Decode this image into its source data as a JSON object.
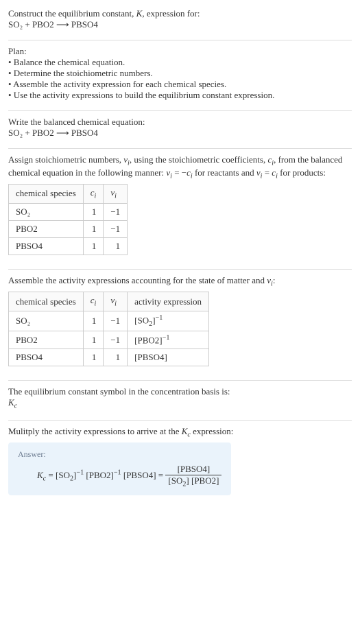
{
  "intro": {
    "line1": "Construct the equilibrium constant, K, expression for:",
    "equation": "SO₂ + PBO2  ⟶  PBSO4"
  },
  "plan": {
    "heading": "Plan:",
    "items": [
      "• Balance the chemical equation.",
      "• Determine the stoichiometric numbers.",
      "• Assemble the activity expression for each chemical species.",
      "• Use the activity expressions to build the equilibrium constant expression."
    ]
  },
  "balanced": {
    "heading": "Write the balanced chemical equation:",
    "equation": "SO₂ + PBO2  ⟶  PBSO4"
  },
  "stoich": {
    "text": "Assign stoichiometric numbers, νᵢ, using the stoichiometric coefficients, cᵢ, from the balanced chemical equation in the following manner: νᵢ = −cᵢ for reactants and νᵢ = cᵢ for products:",
    "headers": [
      "chemical species",
      "cᵢ",
      "νᵢ"
    ],
    "rows": [
      {
        "species": "SO₂",
        "c": "1",
        "v": "−1"
      },
      {
        "species": "PBO2",
        "c": "1",
        "v": "−1"
      },
      {
        "species": "PBSO4",
        "c": "1",
        "v": "1"
      }
    ]
  },
  "activity": {
    "text": "Assemble the activity expressions accounting for the state of matter and νᵢ:",
    "headers": [
      "chemical species",
      "cᵢ",
      "νᵢ",
      "activity expression"
    ],
    "rows": [
      {
        "species": "SO₂",
        "c": "1",
        "v": "−1",
        "expr": "[SO₂]⁻¹"
      },
      {
        "species": "PBO2",
        "c": "1",
        "v": "−1",
        "expr": "[PBO2]⁻¹"
      },
      {
        "species": "PBSO4",
        "c": "1",
        "v": "1",
        "expr": "[PBSO4]"
      }
    ]
  },
  "symbol": {
    "line1": "The equilibrium constant symbol in the concentration basis is:",
    "line2": "K_c"
  },
  "multiply": {
    "text": "Mulitply the activity expressions to arrive at the K_c expression:"
  },
  "answer": {
    "label": "Answer:",
    "lhs": "K_c = [SO₂]⁻¹ [PBO2]⁻¹ [PBSO4] = ",
    "frac_num": "[PBSO4]",
    "frac_den": "[SO₂] [PBO2]"
  }
}
